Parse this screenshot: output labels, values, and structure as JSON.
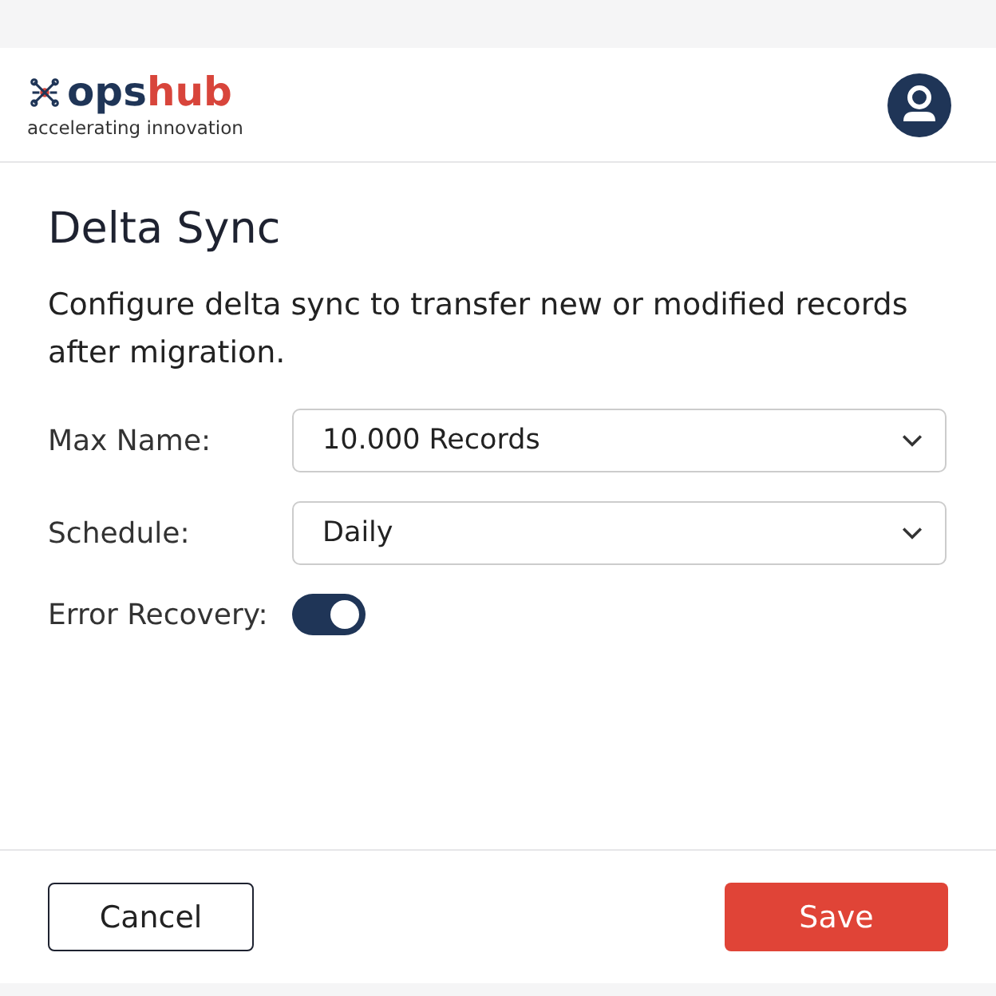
{
  "header": {
    "logo": {
      "parts": [
        "ops",
        "hub"
      ],
      "tagline": "accelerating innovation"
    }
  },
  "title": "Delta Sync",
  "description": "Configure delta sync to transfer new or modified records after migration.",
  "fields": [
    {
      "kind": "select",
      "label": "Max Name:",
      "value": "10.000 Records"
    },
    {
      "kind": "select",
      "label": "Schedule:",
      "value": "Daily"
    },
    {
      "kind": "toggle",
      "label": "Error Recovery:",
      "on": true
    }
  ],
  "buttons": [
    {
      "kind": "secondary",
      "label": "Cancel"
    },
    {
      "kind": "primary",
      "label": "Save"
    }
  ]
}
